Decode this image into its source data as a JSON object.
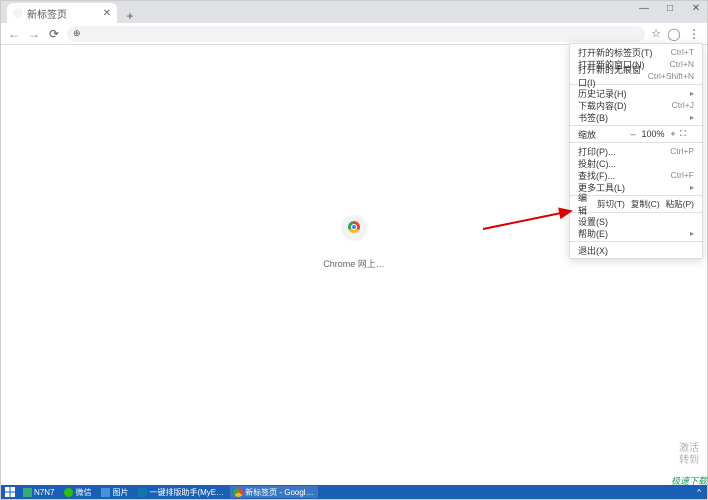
{
  "tab": {
    "title": "新标签页"
  },
  "window_controls": {
    "min": "—",
    "max": "□",
    "close": "✕"
  },
  "toolbar": {
    "back": "←",
    "forward": "→",
    "reload": "⟳",
    "search_icon": "⊕",
    "star": "☆",
    "profile": "◯",
    "menu": "⋮"
  },
  "content": {
    "label": "Chrome 网上…"
  },
  "menu": {
    "new_tab": {
      "label": "打开新的标签页(T)",
      "shortcut": "Ctrl+T"
    },
    "new_window": {
      "label": "打开新的窗口(N)",
      "shortcut": "Ctrl+N"
    },
    "incognito": {
      "label": "打开新的无痕窗口(I)",
      "shortcut": "Ctrl+Shift+N"
    },
    "history": {
      "label": "历史记录(H)"
    },
    "downloads": {
      "label": "下载内容(D)",
      "shortcut": "Ctrl+J"
    },
    "bookmarks": {
      "label": "书签(B)"
    },
    "zoom": {
      "label": "缩放",
      "minus": "–",
      "value": "100%",
      "plus": "+",
      "full": "⛶"
    },
    "print": {
      "label": "打印(P)...",
      "shortcut": "Ctrl+P"
    },
    "cast": {
      "label": "投射(C)..."
    },
    "find": {
      "label": "查找(F)...",
      "shortcut": "Ctrl+F"
    },
    "more_tools": {
      "label": "更多工具(L)"
    },
    "edit": {
      "label": "编辑",
      "cut": "剪切(T)",
      "copy": "复制(C)",
      "paste": "粘贴(P)"
    },
    "settings": {
      "label": "设置(S)"
    },
    "help": {
      "label": "帮助(E)"
    },
    "exit": {
      "label": "退出(X)"
    }
  },
  "watermark": {
    "line1": "激活",
    "line2": "转到"
  },
  "corner": "极速下载",
  "taskbar": {
    "items": [
      {
        "label": "N7N7"
      },
      {
        "label": "微信"
      },
      {
        "label": "图片"
      },
      {
        "label": "一键排版助手(MyE…"
      },
      {
        "label": "新标签页 - Googl…"
      }
    ],
    "tray_up": "^"
  }
}
